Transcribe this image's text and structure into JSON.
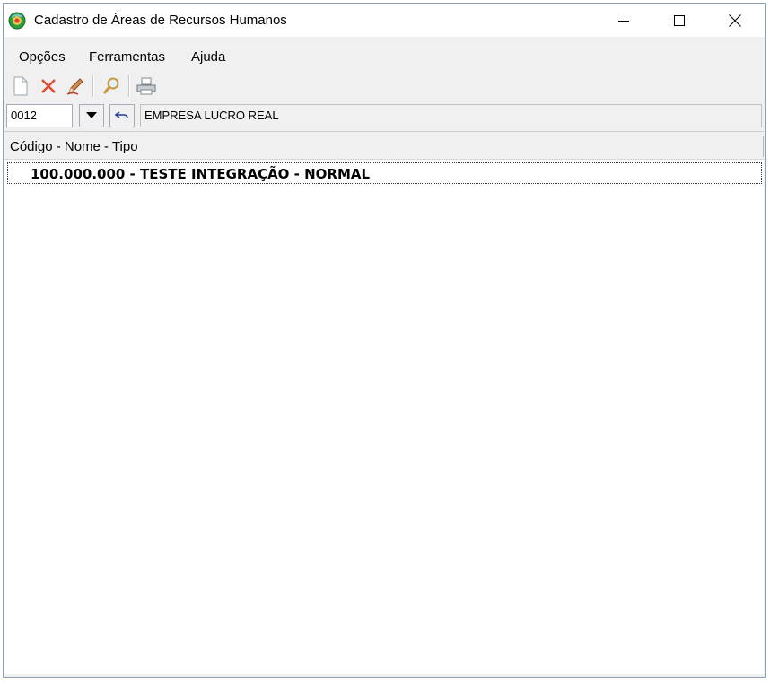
{
  "window": {
    "title": "Cadastro de Áreas de Recursos Humanos",
    "controls": [
      "minimize",
      "maximize",
      "close"
    ]
  },
  "menu": {
    "items": [
      "Opções",
      "Ferramentas",
      "Ajuda"
    ]
  },
  "toolbar": {
    "buttons": [
      {
        "name": "new-document-icon"
      },
      {
        "name": "delete-icon"
      },
      {
        "name": "edit-pencil-icon"
      },
      {
        "name": "search-icon"
      },
      {
        "name": "print-icon"
      }
    ]
  },
  "company": {
    "code": "0012",
    "name": "EMPRESA LUCRO REAL"
  },
  "tree": {
    "header": "Código - Nome - Tipo",
    "rows": [
      {
        "label": "100.000.000 - TESTE INTEGRAÇÃO - NORMAL"
      }
    ]
  },
  "colors": {
    "window_border": "#8aa1b7",
    "chrome_bg": "#f0f0f0",
    "delete_red": "#e04a2f"
  }
}
